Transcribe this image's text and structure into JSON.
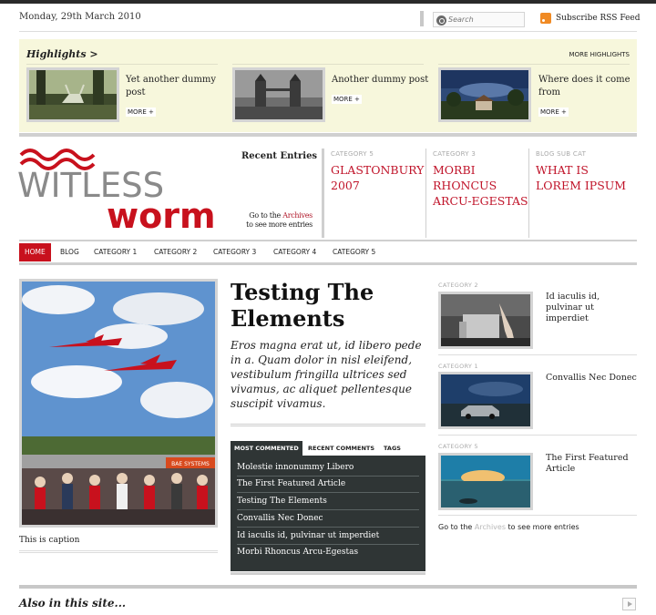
{
  "header": {
    "date": "Monday, 29th March 2010",
    "search_placeholder": "Search",
    "rss_label": "Subscribe RSS Feed"
  },
  "highlights": {
    "title": "Highlights >",
    "more_label": "MORE HIGHLIGHTS",
    "items": [
      {
        "title": "Yet another dummy post",
        "more": "MORE +",
        "image": "deer-forest"
      },
      {
        "title": "Another dummy post",
        "more": "MORE +",
        "image": "tower-bridge"
      },
      {
        "title": "Where does it come from",
        "more": "MORE +",
        "image": "cottage-sky"
      }
    ]
  },
  "logo": {
    "line1": "WITLESS",
    "line2": "worm"
  },
  "recent": {
    "title": "Recent Entries",
    "archive_pre": "Go to the",
    "archive_link": "Archives",
    "archive_post": "to see more entries",
    "columns": [
      {
        "category": "CATEGORY 5",
        "headline": "GLASTONBURY 2007"
      },
      {
        "category": "CATEGORY 3",
        "headline": "MORBI RHONCUS ARCU-EGESTAS"
      },
      {
        "category": "BLOG SUB CAT",
        "headline": "WHAT IS LOREM IPSUM"
      }
    ]
  },
  "nav": [
    "HOME",
    "BLOG",
    "CATEGORY 1",
    "CATEGORY 2",
    "CATEGORY 3",
    "CATEGORY 4",
    "CATEGORY 5"
  ],
  "main": {
    "caption": "This is caption",
    "title": "Testing The Elements",
    "excerpt": "Eros magna erat ut, id libero pede in a. Quam dolor in nisl eleifend, vestibulum fringilla ultrices sed vivamus, ac aliquet pellentesque suscipit vivamus.",
    "image_banner": "BAE SYSTEMS"
  },
  "tabs": {
    "labels": [
      "MOST COMMENTED",
      "RECENT COMMENTS",
      "TAGS"
    ],
    "links": [
      "Molestie innonummy Libero",
      "The First Featured Article",
      "Testing The Elements",
      "Convallis Nec Donec",
      "Id iaculis id, pulvinar ut imperdiet",
      "Morbi Rhoncus Arcu-Egestas"
    ]
  },
  "side": {
    "items": [
      {
        "category": "CATEGORY 2",
        "title": "Id iaculis id, pulvinar ut imperdiet",
        "image": "woman-chair"
      },
      {
        "category": "CATEGORY 1",
        "title": "Convallis Nec Donec",
        "image": "car-desert"
      },
      {
        "category": "CATEGORY 5",
        "title": "The First Featured Article",
        "image": "sea-sunset"
      }
    ],
    "archive_pre": "Go to the",
    "archive_link": "Archives",
    "archive_post": "to see more entries"
  },
  "footer": {
    "also": "Also in this site..."
  },
  "colors": {
    "accent": "#c8111d",
    "highlight_bg": "#f7f7dc",
    "panel_bg": "#2f3535"
  }
}
